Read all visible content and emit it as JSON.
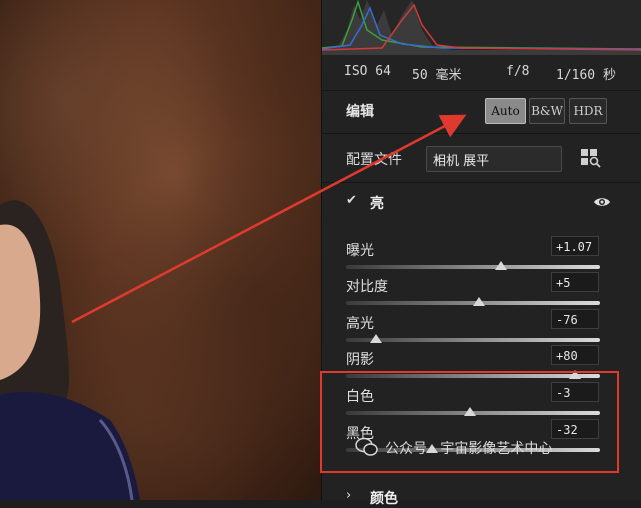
{
  "exif": {
    "iso": "ISO 64",
    "focal": "50 毫米",
    "aperture": "f/8",
    "shutter": "1/160 秒"
  },
  "edit": {
    "title": "编辑",
    "modes": [
      "Auto",
      "B&W",
      "HDR"
    ],
    "active_mode": "Auto"
  },
  "profile": {
    "label": "配置文件",
    "value": "相机 展平"
  },
  "light": {
    "title": "亮",
    "sliders": [
      {
        "name": "曝光",
        "value": "+1.07",
        "pos": 0.61
      },
      {
        "name": "对比度",
        "value": "+5",
        "pos": 0.525
      },
      {
        "name": "高光",
        "value": "-76",
        "pos": 0.12
      },
      {
        "name": "阴影",
        "value": "+80",
        "pos": 0.9
      },
      {
        "name": "白色",
        "value": "-3",
        "pos": 0.49
      },
      {
        "name": "黑色",
        "value": "-32",
        "pos": 0.34
      }
    ]
  },
  "color_section": {
    "title": "颜色"
  },
  "watermark": {
    "text": "公众号 · 宇宙影像艺术中心"
  },
  "colors": {
    "annotation_red": "#e03a2e",
    "active_button": "#8a8a8a"
  }
}
